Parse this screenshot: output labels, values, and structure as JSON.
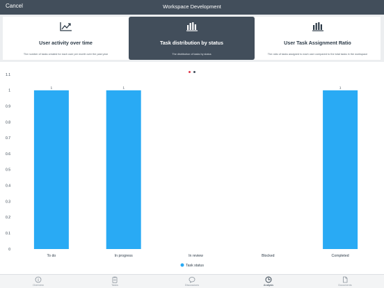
{
  "navbar": {
    "cancel_label": "Cancel",
    "title": "Workspace Development"
  },
  "cards": [
    {
      "icon": "trend-line-icon",
      "title": "User activity over time",
      "description": "The number of tasks created for each user per month over the past year"
    },
    {
      "icon": "bar-chart-icon",
      "title": "Task distribution by status",
      "description": "The distribution of tasks by status"
    },
    {
      "icon": "bar-chart-icon",
      "title": "User Task Assignment Ratio",
      "description": "The ratio of tasks assigned to each user compared to the total tasks in the workspace"
    }
  ],
  "pager": {
    "count": 2,
    "active_index": 0,
    "active_color": "#e0384b",
    "inactive_color": "#424e5b"
  },
  "chart_data": {
    "type": "bar",
    "categories": [
      "To do",
      "In progress",
      "In review",
      "Blocked",
      "Completed"
    ],
    "series": [
      {
        "name": "Task status",
        "values": [
          1,
          1,
          0,
          0,
          1
        ],
        "color": "#29aaf4"
      }
    ],
    "data_labels": [
      "1",
      "1",
      "",
      "",
      "1"
    ],
    "ylim": [
      0,
      1.1
    ],
    "y_ticks": [
      "0",
      "0.1",
      "0.2",
      "0.3",
      "0.4",
      "0.5",
      "0.6",
      "0.7",
      "0.8",
      "0.9",
      "1",
      "1.1"
    ],
    "grid": false,
    "legend_position": "bottom-center"
  },
  "tabbar": {
    "items": [
      {
        "icon": "info-icon",
        "label": "Overview"
      },
      {
        "icon": "clipboard-icon",
        "label": "Tasks"
      },
      {
        "icon": "chat-bubble-icon",
        "label": "Discussions"
      },
      {
        "icon": "clock-chart-icon",
        "label": "Analysis"
      },
      {
        "icon": "document-icon",
        "label": "Documents"
      }
    ],
    "active_index": 3
  }
}
